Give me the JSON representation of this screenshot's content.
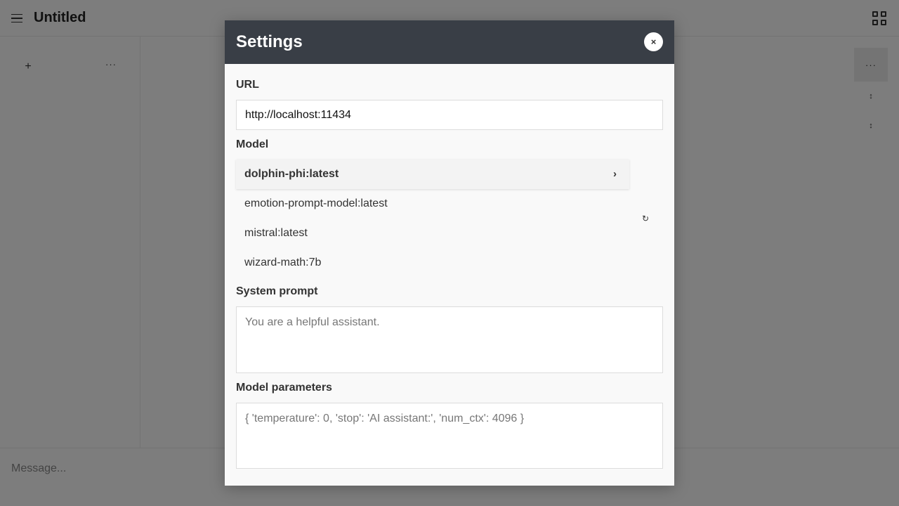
{
  "app": {
    "title": "Untitled",
    "menu_icon": "hamburger-menu-icon",
    "grid_icon": "grid-icon"
  },
  "sidebar": {
    "new_label": "+",
    "more_label": "···"
  },
  "tools": {
    "more_label": "···",
    "arrow1": "↕",
    "arrow2": "↕"
  },
  "message": {
    "placeholder": "Message..."
  },
  "settings": {
    "title": "Settings",
    "close_label": "×",
    "url_label": "URL",
    "url_value": "http://localhost:11434",
    "model_label": "Model",
    "models": [
      {
        "name": "dolphin-phi:latest",
        "selected": true
      },
      {
        "name": "emotion-prompt-model:latest",
        "selected": false
      },
      {
        "name": "mistral:latest",
        "selected": false
      },
      {
        "name": "wizard-math:7b",
        "selected": false
      }
    ],
    "selected_chevron": "›",
    "refresh_icon": "↻",
    "system_prompt_label": "System prompt",
    "system_prompt_placeholder": "You are a helpful assistant.",
    "model_params_label": "Model parameters",
    "model_params_placeholder": "{ 'temperature': 0, 'stop': 'AI assistant:', 'num_ctx': 4096 }"
  }
}
